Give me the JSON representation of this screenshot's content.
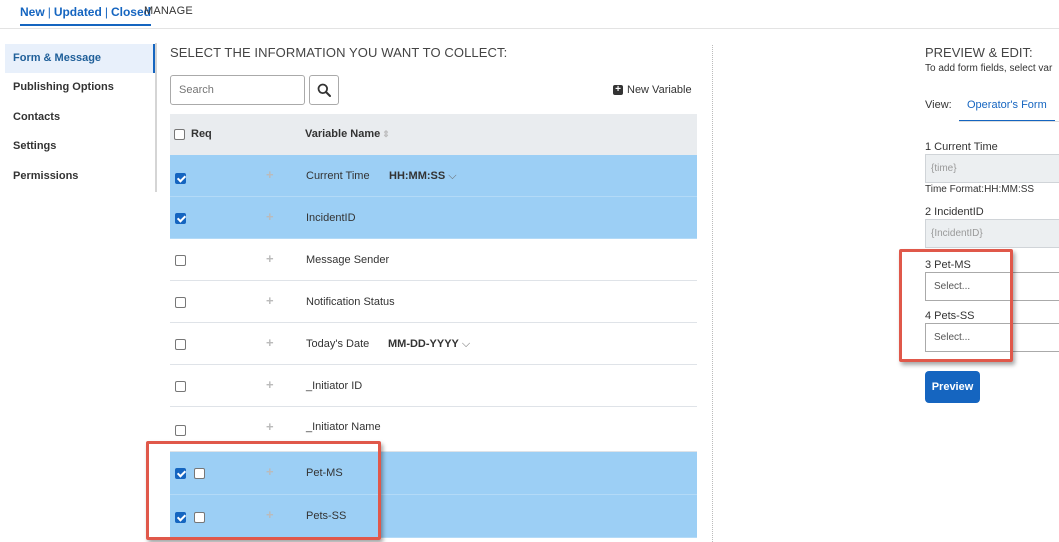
{
  "top_tabs": {
    "active": {
      "part1": "New",
      "sep1": "|",
      "part2": "Updated",
      "sep2": "|",
      "part3": "Closed"
    },
    "manage": "MANAGE"
  },
  "sidebar": {
    "items": [
      {
        "label": "Form & Message",
        "active": true
      },
      {
        "label": "Publishing Options"
      },
      {
        "label": "Contacts"
      },
      {
        "label": "Settings"
      },
      {
        "label": "Permissions"
      }
    ]
  },
  "collect": {
    "title": "SELECT THE INFORMATION YOU WANT TO COLLECT:",
    "search_placeholder": "Search",
    "new_variable_label": "New Variable",
    "header": {
      "req": "Req",
      "variable_name": "Variable Name"
    },
    "rows": [
      {
        "name": "Current Time",
        "format": "HH:MM:SS",
        "checked": true
      },
      {
        "name": "IncidentID",
        "checked": true
      },
      {
        "name": "Message Sender",
        "checked": false
      },
      {
        "name": "Notification Status",
        "checked": false
      },
      {
        "name": "Today's Date",
        "format": "MM-DD-YYYY",
        "checked": false
      },
      {
        "name": "_Initiator ID",
        "checked": false
      },
      {
        "name": "_Initiator Name",
        "checked": false
      },
      {
        "name": "Pet-MS",
        "checked": true,
        "req": false
      },
      {
        "name": "Pets-SS",
        "checked": true,
        "req": false
      }
    ]
  },
  "preview": {
    "title": "PREVIEW & EDIT:",
    "subtitle": "To add form fields, select var",
    "view_label": "View:",
    "view_tab": "Operator's Form",
    "button": "Preview",
    "fields": [
      {
        "label": "1 Current Time",
        "value": "{time}",
        "note": "Time Format:HH:MM:SS"
      },
      {
        "label": "2 IncidentID",
        "value": "{IncidentID}"
      },
      {
        "label": "3 Pet-MS",
        "placeholder": "Select..."
      },
      {
        "label": "4 Pets-SS",
        "placeholder": "Select..."
      }
    ]
  },
  "colors": {
    "accent": "#1565c0",
    "selected_row": "#9ccff5",
    "highlight": "#e0584a"
  }
}
